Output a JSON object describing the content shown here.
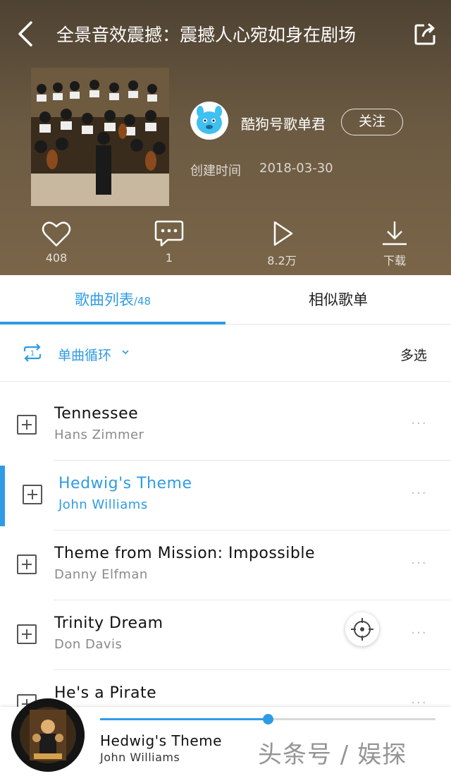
{
  "header": {
    "title": "全景音效震撼：震撼人心宛如身在剧场",
    "creator_name": "酷狗号歌单君",
    "follow_label": "关注",
    "created_label": "创建时间",
    "created_date": "2018-03-30",
    "actions": [
      {
        "icon": "heart-icon",
        "label": "408"
      },
      {
        "icon": "comment-icon",
        "label": "1"
      },
      {
        "icon": "play-icon",
        "label": "8.2万"
      },
      {
        "icon": "download-icon",
        "label": "下载"
      }
    ]
  },
  "tabs": {
    "songs_label": "歌曲列表",
    "songs_count": "/48",
    "similar_label": "相似歌单"
  },
  "modebar": {
    "mode_label": "单曲循环",
    "multi_select_label": "多选"
  },
  "songs": [
    {
      "title": "Tennessee",
      "artist": "Hans Zimmer"
    },
    {
      "title": "Hedwig's Theme",
      "artist": "John Williams",
      "playing": true
    },
    {
      "title": "Theme from Mission: Impossible",
      "artist": "Danny Elfman"
    },
    {
      "title": "Trinity Dream",
      "artist": "Don Davis"
    },
    {
      "title": "He's a Pirate",
      "artist": ""
    }
  ],
  "more_label": "···",
  "player": {
    "title": "Hedwig's Theme",
    "artist": "John Williams",
    "progress": 0.5
  },
  "watermark": "头条号 / 娱探",
  "colors": {
    "accent": "#2f9be5",
    "header_bg": "#6b5a42"
  }
}
